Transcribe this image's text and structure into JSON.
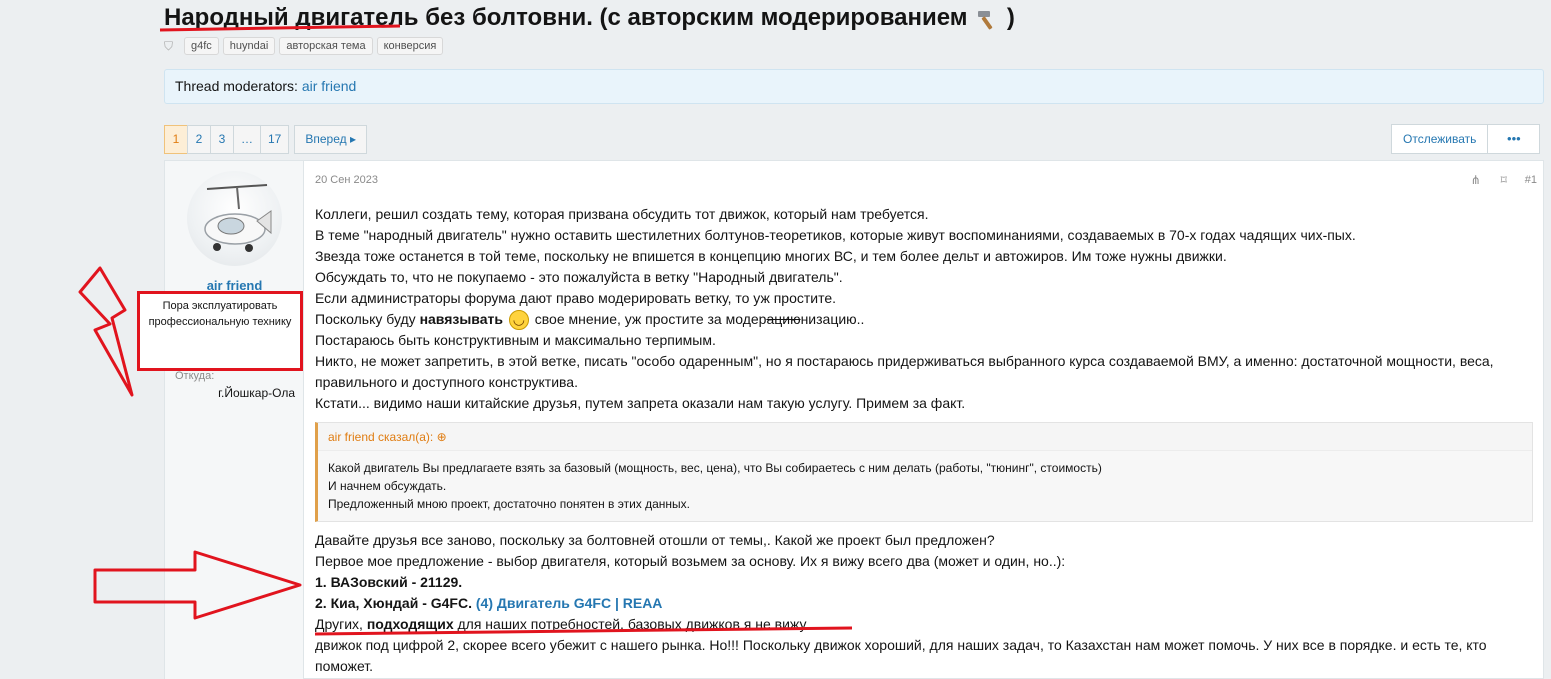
{
  "thread": {
    "title": "Народный двигатель без болтовни. (с авторским модерированием",
    "title_icon": "hammer-icon",
    "tags": [
      "g4fc",
      "huyndai",
      "авторская тема",
      "конверсия"
    ]
  },
  "moderators": {
    "label": "Thread moderators:",
    "name": "air friend"
  },
  "pagination": {
    "pages": [
      "1",
      "2",
      "3",
      "…",
      "17"
    ],
    "current": "1",
    "next_label": "Вперед ▸"
  },
  "actions": {
    "watch_label": "Отслеживать",
    "more_label": "•••"
  },
  "post": {
    "author": "air friend",
    "user_title": "Пора эксплуатировать профессиональную технику",
    "from_label": "Откуда:",
    "from_value": "г.Йошкар-Ола",
    "date": "20 Сен 2023",
    "number": "#1",
    "lines": [
      "Коллеги, решил создать тему, которая призвана обсудить тот движок, который нам требуется.",
      "В теме \"народный двигатель\" нужно оставить шестилетних болтунов-теоретиков, которые живут воспоминаниями, создаваемых в 70-х годах чадящих чих-пых.",
      "Звезда тоже останется в той теме, поскольку не впишется в концепцию многих ВС, и тем более дельт и автожиров. Им тоже нужны движки.",
      "Обсуждать то, что не покупаемо - это пожалуйста в ветку \"Народный двигатель\".",
      "Если администраторы форума дают право модерировать ветку, то уж простите."
    ],
    "line6": {
      "before": "Поскольку буду ",
      "bold": "навязывать",
      "after1": " свое мнение, уж простите за модер",
      "strike": "ацию",
      "after2": "низацию.."
    },
    "lines2": [
      "Постараюсь быть конструктивным и максимально терпимым.",
      "Никто, не может запретить, в этой ветке, писать \"особо одаренным\", но я постараюсь придерживаться выбранного курса создаваемой ВМУ, а именно: достаточной мощности, веса, правильного и доступного конструктива.",
      "Кстати... видимо наши китайские друзья, путем запрета оказали нам такую услугу. Примем за факт."
    ],
    "quote": {
      "header": "air friend сказал(а): ⊕",
      "lines": [
        "Какой двигатель Вы предлагаете взять за базовый (мощность, вес, цена), что Вы собираетесь с ним делать (работы, \"тюнинг\", стоимость)",
        "И начнем обсуждать.",
        "Предложенный мною проект, достаточно понятен в этих данных."
      ]
    },
    "lines3": [
      "Давайте друзья все заново, поскольку за болтовней отошли от темы,. Какой же проект был предложен?",
      "Первое мое предложение - выбор двигателя, который возьмем за основу. Их я вижу всего два (может и один, но..):"
    ],
    "option1": "1. ВАЗовский - 21129.",
    "option2": "2. Киа, Хюндай - G4FC.",
    "option2_link": "(4) Двигатель G4FC | REAA",
    "others": {
      "before": "Других, ",
      "bold": "подходящих",
      "after": " для наших потребностей, базовых движков я не вижу."
    },
    "last": "движок под цифрой 2, скорее всего убежит с нашего рынка. Но!!! Поскольку движок хороший, для наших задач, то Казахстан нам может помочь. У них все в порядке. и есть те, кто поможет."
  },
  "colors": {
    "accent": "#2577b1",
    "annotation": "#e1141e",
    "quote_border": "#e0a04a"
  }
}
